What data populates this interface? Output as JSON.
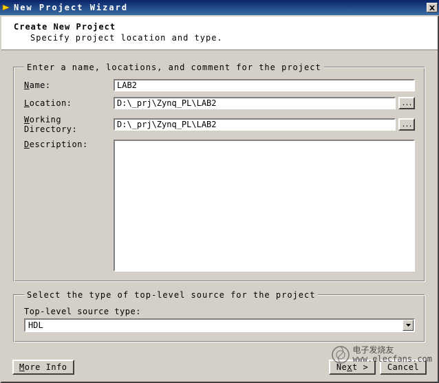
{
  "titlebar": {
    "title": "New Project Wizard",
    "close_label": "×"
  },
  "header": {
    "title": "Create New Project",
    "subtitle": "Specify project location and type."
  },
  "fieldset1": {
    "legend": "Enter a name, locations, and comment for the project",
    "name_label": "Name:",
    "name_u": "N",
    "name_rest": "ame:",
    "name_value": "LAB2",
    "location_label": "Location:",
    "location_u": "L",
    "location_rest": "ocation:",
    "location_value": "D:\\_prj\\Zynq_PL\\LAB2",
    "working_label": "Working Directory:",
    "working_u": "W",
    "working_rest": "orking Directory:",
    "working_value": "D:\\_prj\\Zynq_PL\\LAB2",
    "description_label": "Description:",
    "description_u": "D",
    "description_rest": "escription:",
    "description_value": "",
    "browse": "..."
  },
  "fieldset2": {
    "legend": "Select the type of top-level source for the project",
    "type_label": "Top-level source type:",
    "type_u": "T",
    "type_rest": "op-level source type:",
    "type_value": "HDL"
  },
  "footer": {
    "more_info": "More Info",
    "more_info_u": "M",
    "more_info_rest": "ore Info",
    "next": "Next >",
    "next_pre": "Ne",
    "next_u": "x",
    "next_post": "t >",
    "cancel": "Cancel"
  },
  "watermark": {
    "line1": "电子发烧友",
    "line2": "www.elecfans.com"
  }
}
